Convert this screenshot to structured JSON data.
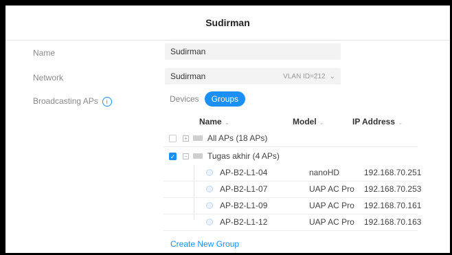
{
  "header": {
    "title": "Sudirman"
  },
  "form": {
    "name_label": "Name",
    "name_value": "Sudirman",
    "network_label": "Network",
    "network_value": "Sudirman",
    "vlan_text": "VLAN ID=212",
    "broadcasting_label": "Broadcasting APs"
  },
  "tabs": {
    "devices": "Devices",
    "groups": "Groups"
  },
  "table": {
    "columns": {
      "name": "Name",
      "model": "Model",
      "ip": "IP Address"
    },
    "groups": [
      {
        "name": "All APs (18 APs)",
        "checked": false,
        "expanded": false
      },
      {
        "name": "Tugas akhir (4 APs)",
        "checked": true,
        "expanded": true
      }
    ],
    "devices": [
      {
        "name": "AP-B2-L1-04",
        "model": "nanoHD",
        "ip": "192.168.70.251"
      },
      {
        "name": "AP-B2-L1-07",
        "model": "UAP AC Pro",
        "ip": "192.168.70.253"
      },
      {
        "name": "AP-B2-L1-09",
        "model": "UAP AC Pro",
        "ip": "192.168.70.161"
      },
      {
        "name": "AP-B2-L1-12",
        "model": "UAP AC Pro",
        "ip": "192.168.70.163"
      }
    ]
  },
  "actions": {
    "create_group": "Create New Group"
  },
  "colors": {
    "accent": "#1a90ff"
  }
}
